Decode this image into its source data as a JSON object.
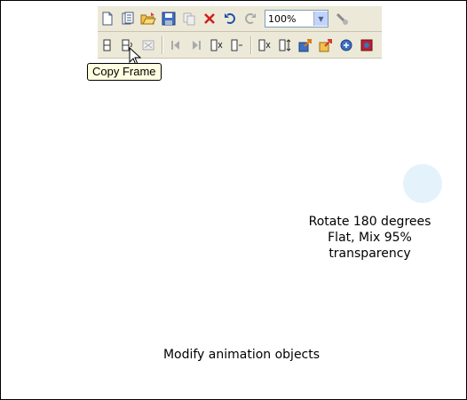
{
  "toolbar": {
    "zoom": {
      "value": "100%"
    },
    "row1_icons": [
      "new-document-icon",
      "new-animation-icon",
      "open-icon",
      "save-icon",
      "copy-icon",
      "delete-icon",
      "undo-icon",
      "redo-icon"
    ],
    "row2_icons": [
      "frame-icon",
      "copy-frame-icon",
      "frame-properties-icon",
      "previous-frame-icon",
      "next-frame-icon",
      "delete-frame-icon",
      "insert-frame-icon",
      "clear-frame-icon",
      "frame-gallery-icon",
      "export-icon",
      "export-animation-icon",
      "preview-icon",
      "preview-browser-icon"
    ]
  },
  "tooltip": {
    "text": "Copy Frame"
  },
  "caption": {
    "line1": "Rotate 180 degrees",
    "line2": "Flat, Mix 95%",
    "line3": "transparency"
  },
  "footer": {
    "text": "Modify animation objects"
  },
  "colors": {
    "circle_fill": "#e3f2fb",
    "tooltip_bg": "#ffffe1",
    "toolbar_bg": "#ece9d8"
  }
}
